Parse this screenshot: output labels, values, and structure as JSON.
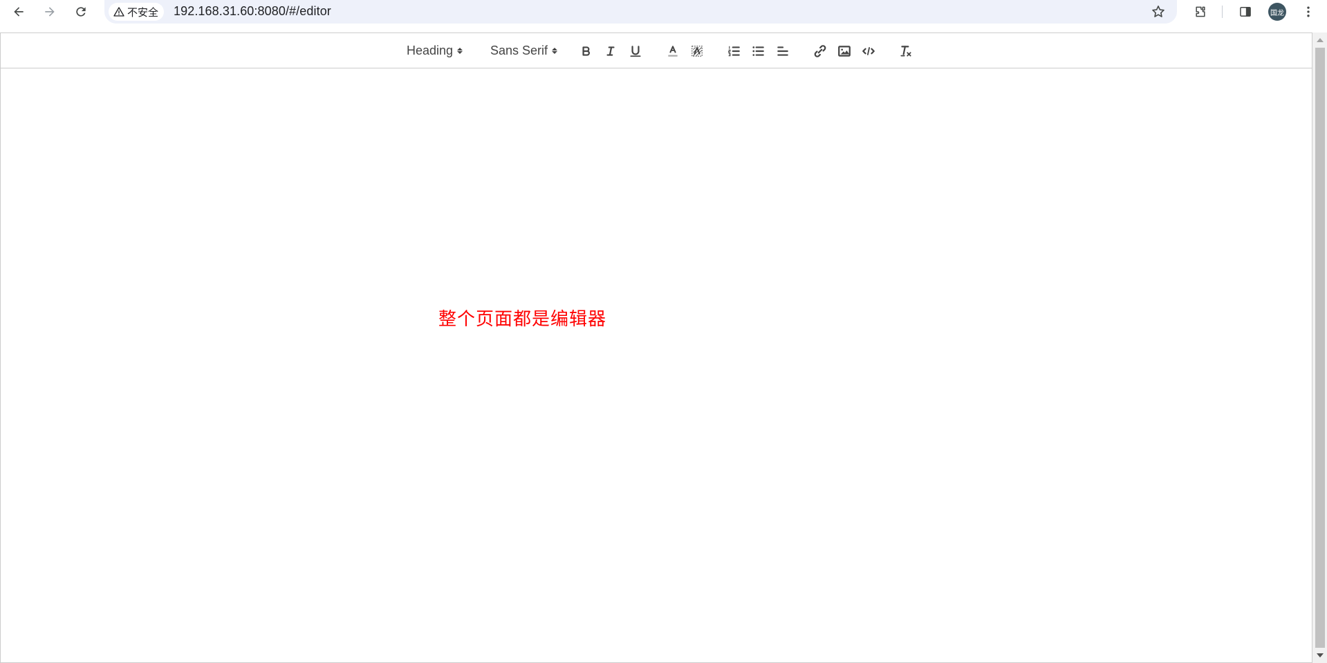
{
  "browser": {
    "security_label": "不安全",
    "url": "192.168.31.60:8080/#/editor",
    "profile_initials": "国龙",
    "icons": [
      "back-arrow-icon",
      "forward-arrow-icon",
      "reload-icon",
      "warning-icon",
      "star-icon",
      "extensions-icon",
      "side-panel-icon",
      "kebab-menu-icon"
    ]
  },
  "toolbar": {
    "heading_picker": "Heading",
    "font_picker": "Sans Serif",
    "buttons": [
      "bold-icon",
      "italic-icon",
      "underline-icon",
      "text-color-icon",
      "background-color-icon",
      "ordered-list-icon",
      "bullet-list-icon",
      "align-icon",
      "link-icon",
      "image-icon",
      "code-block-icon",
      "clear-format-icon"
    ]
  },
  "editor": {
    "annotation": "整个页面都是编辑器",
    "annotation_color": "#ff0000"
  }
}
